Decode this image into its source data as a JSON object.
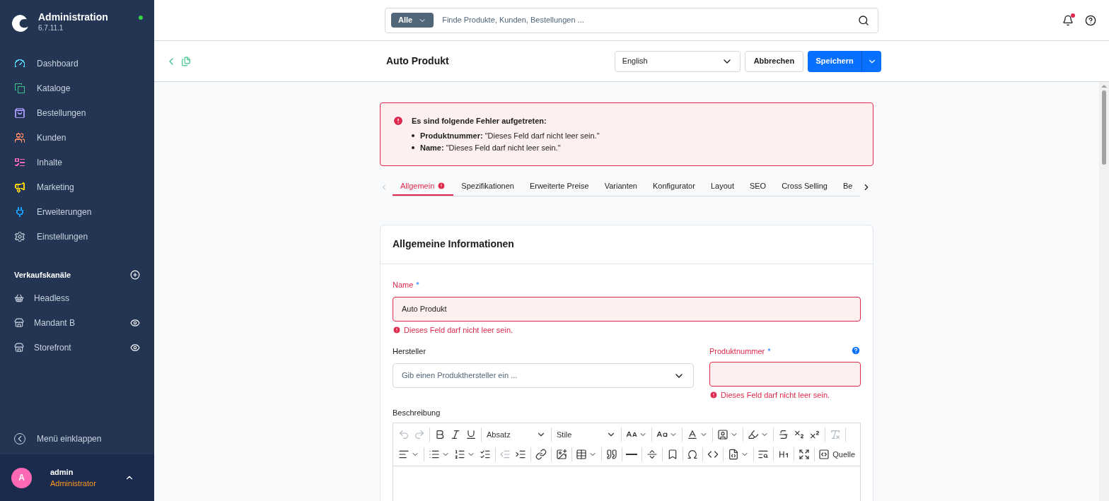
{
  "sidebar": {
    "brand": {
      "title": "Administration",
      "version": "6.7.11.1"
    },
    "nav": [
      {
        "kind": "dashboard",
        "label": "Dashboard",
        "color": "#57d9f9"
      },
      {
        "kind": "catalog",
        "label": "Kataloge",
        "color": "#3cc28b"
      },
      {
        "kind": "orders",
        "label": "Bestellungen",
        "color": "#a092f0"
      },
      {
        "kind": "customers",
        "label": "Kunden",
        "color": "#f88962"
      },
      {
        "kind": "content",
        "label": "Inhalte",
        "color": "#ff68b4"
      },
      {
        "kind": "marketing",
        "label": "Marketing",
        "color": "#ffd700"
      },
      {
        "kind": "extensions",
        "label": "Erweiterungen",
        "color": "#189eff"
      },
      {
        "kind": "settings",
        "label": "Einstellungen",
        "color": "#9aa8b5"
      }
    ],
    "sales_channels": {
      "title": "Verkaufskanäle",
      "items": [
        {
          "kind": "headless",
          "label": "Headless",
          "eye": false
        },
        {
          "kind": "storefront",
          "label": "Mandant B",
          "eye": true
        },
        {
          "kind": "storefront",
          "label": "Storefront",
          "eye": true
        }
      ]
    },
    "collapse": "Menü einklappen",
    "user": {
      "initial": "A",
      "name": "admin",
      "role": "Administrator"
    }
  },
  "search": {
    "scope": "Alle",
    "placeholder": "Finde Produkte, Kunden, Bestellungen ..."
  },
  "notifications": {
    "unread": true
  },
  "header": {
    "title": "Auto Produkt",
    "language": "English",
    "cancel": "Abbrechen",
    "save": "Speichern"
  },
  "error_alert": {
    "title": "Es sind folgende Fehler aufgetreten:",
    "items": [
      {
        "field": "Produktnummer:",
        "message": "\"Dieses Feld darf nicht leer sein.\""
      },
      {
        "field": "Name:",
        "message": "\"Dieses Feld darf nicht leer sein.\""
      }
    ]
  },
  "tabs": [
    {
      "label": "Allgemein",
      "selected": true,
      "error": true
    },
    {
      "label": "Spezifikationen",
      "selected": false,
      "error": false
    },
    {
      "label": "Erweiterte Preise",
      "selected": false,
      "error": false
    },
    {
      "label": "Varianten",
      "selected": false,
      "error": false
    },
    {
      "label": "Konfigurator",
      "selected": false,
      "error": false
    },
    {
      "label": "Layout",
      "selected": false,
      "error": false
    },
    {
      "label": "SEO",
      "selected": false,
      "error": false
    },
    {
      "label": "Cross Selling",
      "selected": false,
      "error": false
    },
    {
      "label": "Be",
      "selected": false,
      "error": false
    }
  ],
  "card": {
    "title": "Allgemeine Informationen",
    "name": {
      "label": "Name",
      "required_mark": "*",
      "value": "Auto Produkt",
      "error": "Dieses Feld darf nicht leer sein."
    },
    "manufacturer": {
      "label": "Hersteller",
      "placeholder": "Gib einen Produkthersteller ein ..."
    },
    "product_number": {
      "label": "Produktnummer",
      "required_mark": "*",
      "error": "Dieses Feld darf nicht leer sein."
    },
    "description": {
      "label": "Beschreibung",
      "toolbar": [
        [
          {
            "kind": "undo",
            "disabled": true
          },
          {
            "kind": "redo",
            "disabled": true
          },
          {
            "kind": "divider"
          },
          {
            "kind": "bold",
            "disabled": false
          },
          {
            "kind": "italic",
            "disabled": false
          },
          {
            "kind": "underline",
            "disabled": false
          },
          {
            "kind": "divider"
          },
          {
            "kind": "select",
            "label": "Absatz",
            "disabled": false
          },
          {
            "kind": "divider"
          },
          {
            "kind": "select",
            "label": "Stile",
            "disabled": false
          },
          {
            "kind": "divider"
          },
          {
            "kind": "font_size",
            "caret": true,
            "disabled": false
          },
          {
            "kind": "divider"
          },
          {
            "kind": "font_family",
            "caret": true,
            "disabled": false
          },
          {
            "kind": "divider"
          },
          {
            "kind": "font_color",
            "caret": true,
            "disabled": false
          },
          {
            "kind": "divider"
          },
          {
            "kind": "bg_color",
            "caret": true,
            "disabled": false
          },
          {
            "kind": "divider"
          },
          {
            "kind": "highlight",
            "caret": true,
            "disabled": false
          },
          {
            "kind": "divider"
          },
          {
            "kind": "strike",
            "disabled": false
          },
          {
            "kind": "subscript",
            "disabled": false
          },
          {
            "kind": "superscript",
            "disabled": false
          },
          {
            "kind": "divider"
          },
          {
            "kind": "remove_format",
            "disabled": true
          },
          {
            "kind": "divider"
          }
        ],
        [
          {
            "kind": "align",
            "caret": true,
            "disabled": false
          },
          {
            "kind": "divider"
          },
          {
            "kind": "bullets",
            "caret": true,
            "disabled": false
          },
          {
            "kind": "numbered",
            "caret": true,
            "disabled": false
          },
          {
            "kind": "todo",
            "disabled": false
          },
          {
            "kind": "divider"
          },
          {
            "kind": "outdent",
            "disabled": true
          },
          {
            "kind": "indent",
            "disabled": false
          },
          {
            "kind": "divider"
          },
          {
            "kind": "link",
            "disabled": false
          },
          {
            "kind": "divider"
          },
          {
            "kind": "image",
            "disabled": false
          },
          {
            "kind": "divider"
          },
          {
            "kind": "table",
            "caret": true,
            "disabled": false
          },
          {
            "kind": "divider"
          },
          {
            "kind": "quote",
            "disabled": false
          },
          {
            "kind": "divider"
          },
          {
            "kind": "hr",
            "disabled": false
          },
          {
            "kind": "divider"
          },
          {
            "kind": "page_break",
            "disabled": false
          },
          {
            "kind": "divider"
          },
          {
            "kind": "bookmark",
            "disabled": false
          },
          {
            "kind": "divider"
          },
          {
            "kind": "special_chars",
            "disabled": false
          },
          {
            "kind": "divider"
          },
          {
            "kind": "code",
            "disabled": false
          },
          {
            "kind": "divider"
          },
          {
            "kind": "code_block",
            "caret": true,
            "disabled": false
          },
          {
            "kind": "divider"
          },
          {
            "kind": "find",
            "disabled": false
          },
          {
            "kind": "divider"
          },
          {
            "kind": "show_blocks",
            "disabled": false
          },
          {
            "kind": "divider"
          },
          {
            "kind": "fullscreen",
            "disabled": false
          },
          {
            "kind": "divider"
          },
          {
            "kind": "source",
            "label": "Quelle",
            "disabled": false
          }
        ]
      ]
    }
  }
}
